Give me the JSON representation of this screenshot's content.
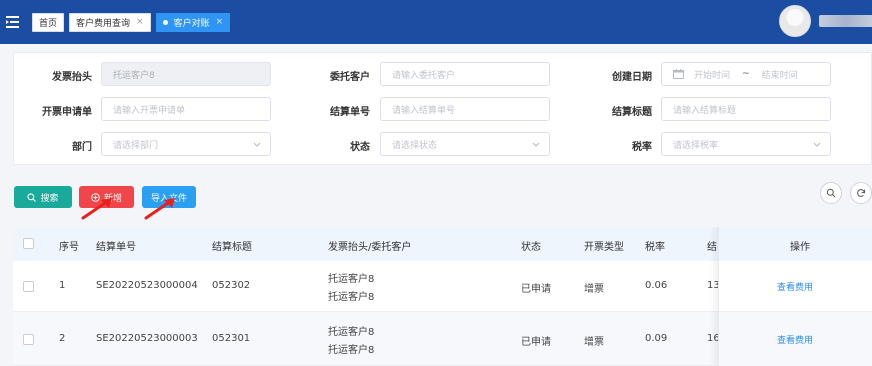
{
  "header": {
    "tabs": [
      {
        "label": "首页",
        "closable": false,
        "active": false
      },
      {
        "label": "客户费用查询",
        "closable": true,
        "active": false
      },
      {
        "label": "客户对账",
        "closable": true,
        "active": true
      }
    ],
    "close_glyph": "×"
  },
  "filters": {
    "invoice_title": {
      "label": "发票抬头",
      "value": "托运客户8"
    },
    "entrust_customer": {
      "label": "委托客户",
      "placeholder": "请输入委托客户"
    },
    "create_date": {
      "label": "创建日期",
      "start_placeholder": "开始时间",
      "separator": "~",
      "end_placeholder": "结束时间"
    },
    "invoice_request": {
      "label": "开票申请单",
      "placeholder": "请输入开票申请单"
    },
    "settlement_no": {
      "label": "结算单号",
      "placeholder": "请输入结算单号"
    },
    "settlement_title": {
      "label": "结算标题",
      "placeholder": "请输入结算标题"
    },
    "department": {
      "label": "部门",
      "placeholder": "请选择部门"
    },
    "status": {
      "label": "状态",
      "placeholder": "请选择状态"
    },
    "tax_rate": {
      "label": "税率",
      "placeholder": "请选择税率"
    }
  },
  "actions": {
    "search": "搜索",
    "add": "新增",
    "import": "导入文件"
  },
  "table": {
    "headers": [
      "序号",
      "结算单号",
      "结算标题",
      "发票抬头/委托客户",
      "状态",
      "开票类型",
      "税率",
      "结",
      "操作"
    ],
    "rows": [
      {
        "index": "1",
        "settlement_no": "SE20220523000004",
        "title": "052302",
        "invoice_title": "托运客户8",
        "customer": "托运客户8",
        "status": "已申请",
        "invoice_type": "增票",
        "tax_rate": "0.06",
        "partial": "13",
        "action": "查看费用"
      },
      {
        "index": "2",
        "settlement_no": "SE20220523000003",
        "title": "052301",
        "invoice_title": "托运客户8",
        "customer": "托运客户8",
        "status": "已申请",
        "invoice_type": "增票",
        "tax_rate": "0.09",
        "partial": "16",
        "action": "查看费用"
      }
    ]
  },
  "colors": {
    "topbar": "#1b4ea3",
    "active_tab": "#2f95f5",
    "search_button": "#1aaa9b",
    "add_button": "#f0464a",
    "import_button": "#2b9ff2",
    "arrow": "#e8201d",
    "link": "#2b8ff0"
  },
  "icons": [
    "menu-toggle-icon",
    "avatar",
    "calendar-icon",
    "chevron-down-icon",
    "search-icon",
    "plus-circle-icon",
    "refresh-icon"
  ]
}
